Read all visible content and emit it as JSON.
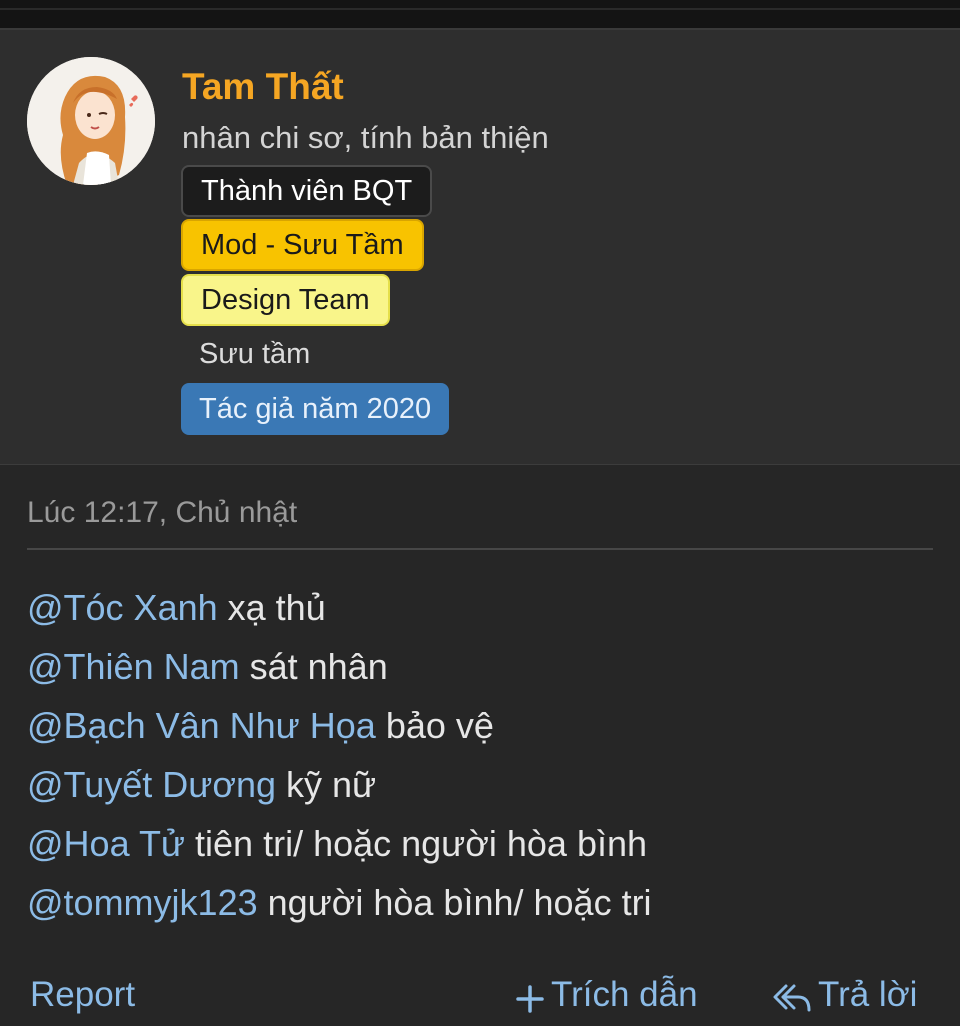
{
  "user": {
    "name": "Tam Thất",
    "title": "nhân chi sơ, tính bản thiện",
    "banners": [
      {
        "label": "Thành viên BQT"
      },
      {
        "label": "Mod - Sưu Tầm"
      },
      {
        "label": "Design Team"
      },
      {
        "label": "Sưu tầm"
      },
      {
        "label": "Tác giả năm 2020"
      }
    ]
  },
  "post": {
    "time": "Lúc 12:17, Chủ nhật",
    "lines": [
      {
        "mention": "@Tóc Xanh",
        "text": " xạ thủ"
      },
      {
        "mention": "@Thiên Nam",
        "text": " sát nhân"
      },
      {
        "mention": "@Bạch Vân Như Họa",
        "text": " bảo vệ"
      },
      {
        "mention": "@Tuyết Dương",
        "text": " kỹ nữ"
      },
      {
        "mention": "@Hoa Tử",
        "text": " tiên tri/ hoặc người hòa bình"
      },
      {
        "mention": "@tommyjk123",
        "text": " người hòa bình/ hoặc tri"
      }
    ]
  },
  "actions": {
    "report": "Report",
    "quote": "Trích dẫn",
    "reply": "Trả lời"
  },
  "icons": {
    "quote": "plus-icon",
    "reply": "reply-arrow-icon"
  },
  "colors": {
    "username": "#f5a623",
    "mention": "#8cbbe6",
    "mod_banner": "#f8c300",
    "design_banner": "#f9f58a",
    "author_banner": "#3a78b5"
  }
}
